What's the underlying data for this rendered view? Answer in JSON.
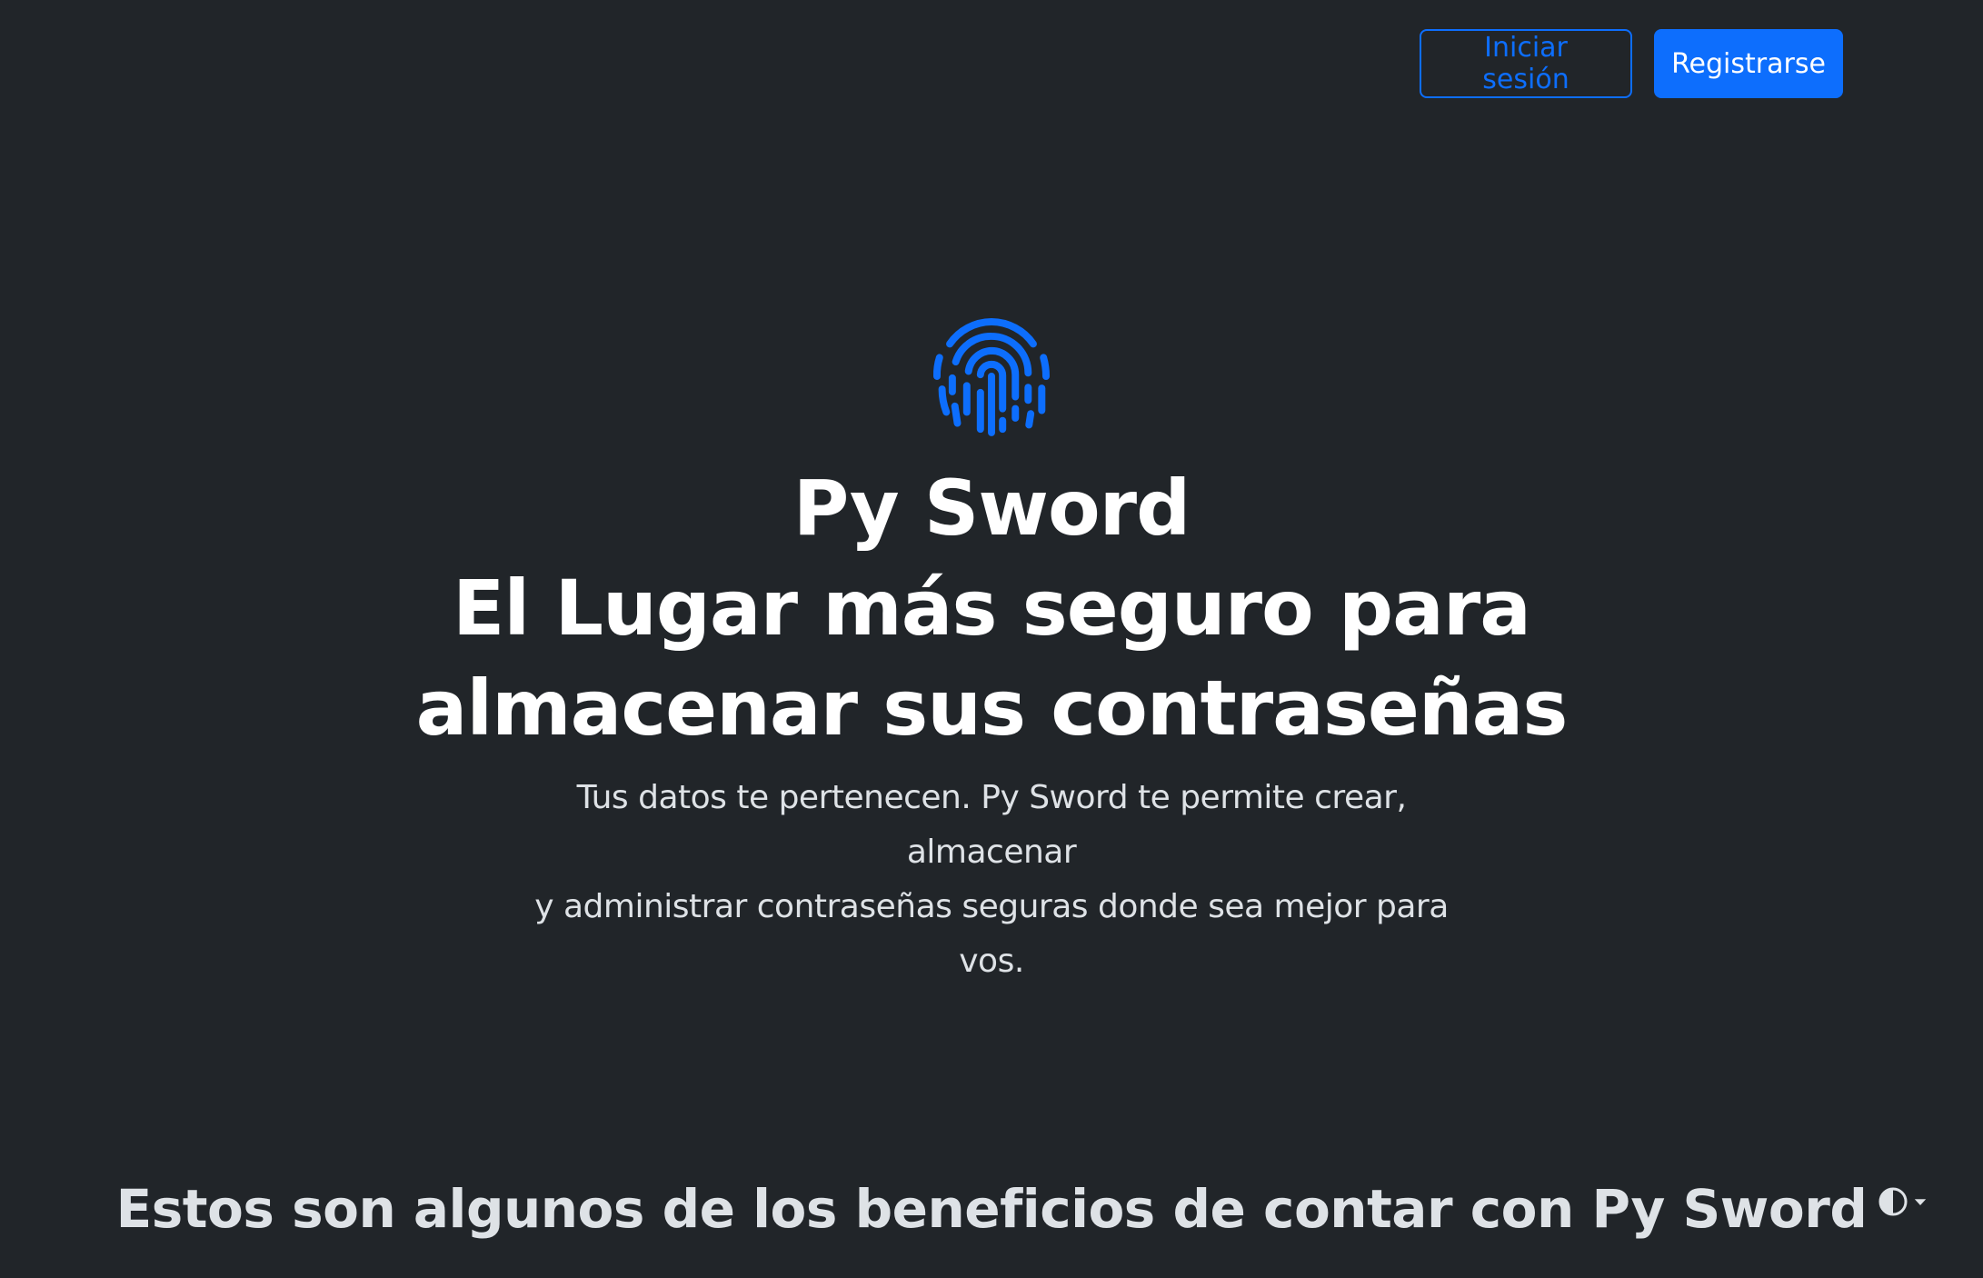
{
  "header": {
    "login_label": "Iniciar sesión",
    "register_label": "Registrarse"
  },
  "hero": {
    "logo_icon": "fingerprint-icon",
    "title_line1": "Py Sword",
    "title_line2": "El Lugar más seguro para",
    "title_line3": "almacenar sus contraseñas",
    "lead_line1": "Tus datos te pertenecen. Py Sword te permite crear, almacenar",
    "lead_line2": "y administrar contraseñas seguras donde sea mejor para vos."
  },
  "benefits": {
    "heading": "Estos son algunos de los beneficios de contar con Py Sword"
  },
  "theme_toggle": {
    "icon": "circle-half-icon",
    "caret_icon": "caret-down-icon"
  },
  "colors": {
    "background": "#212529",
    "accent": "#0d6efd",
    "text": "#ffffff",
    "muted_text": "#dee2e6"
  }
}
